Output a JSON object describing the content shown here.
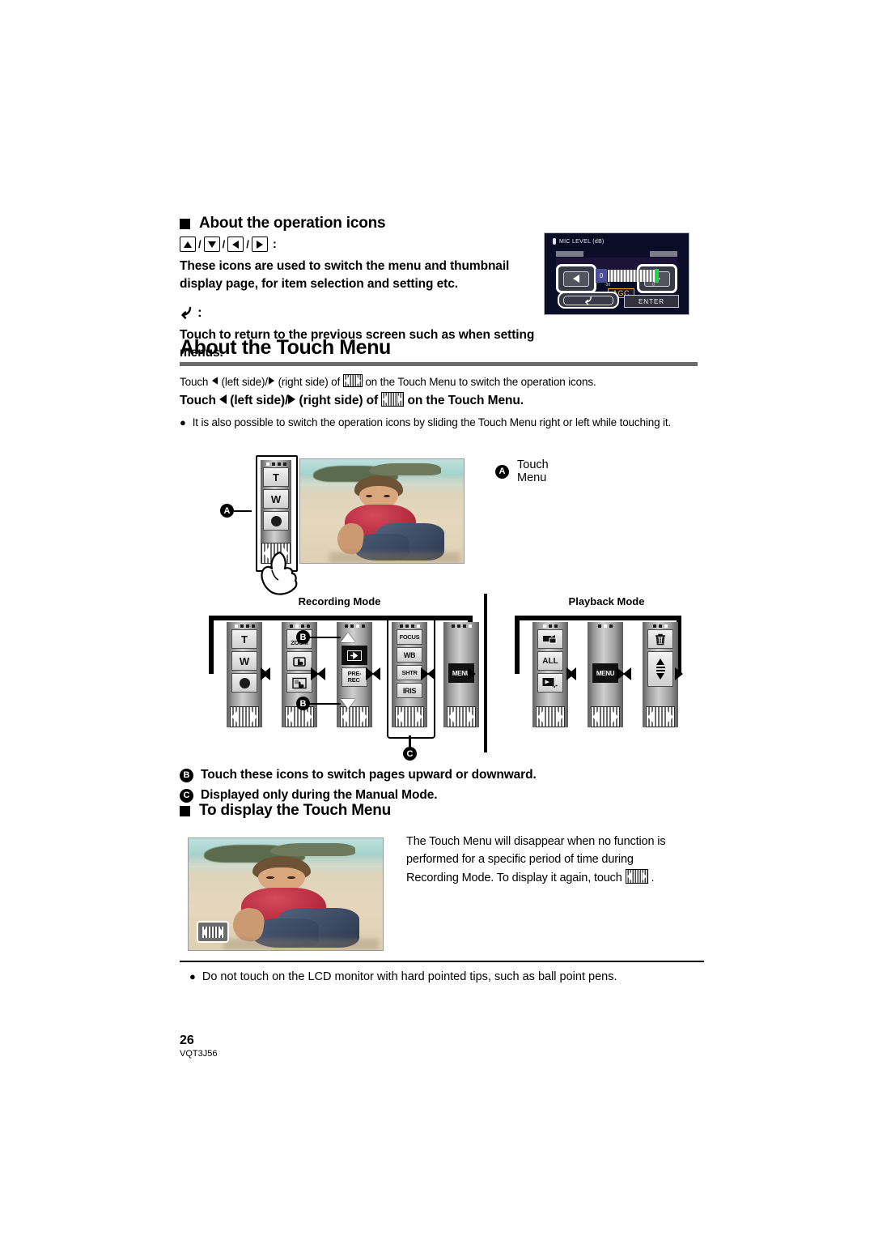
{
  "document": {
    "page_number": "26",
    "doc_code": "VQT3J56"
  },
  "section_operation_icons": {
    "heading": "About the operation icons",
    "arrow_icons_label": ":",
    "arrow_icons_desc": "These icons are used to switch the menu and thumbnail display page, for item selection and setting etc.",
    "return_icon_label": ":",
    "return_icon_desc": "Touch to return to the previous screen such as when setting menus.",
    "lcd": {
      "title": "MIC LEVEL (dB)",
      "value": "0",
      "scale_left": "-30",
      "scale_right": "0",
      "agc_label": "AGC",
      "enter_label": "ENTER",
      "back_label": "↶"
    }
  },
  "section_touch_menu": {
    "title": "About the Touch Menu",
    "line_regular_1": "Touch",
    "line_regular_2": "(left side)/",
    "line_regular_3": "(right side) of",
    "line_regular_4": "on the Touch Menu to switch the operation icons.",
    "line_bold_1": "Touch",
    "line_bold_2": "(left side)/",
    "line_bold_3": "(right side) of",
    "line_bold_4": "on the Touch Menu.",
    "bullet_slide": "It is also possible to switch the operation icons by sliding the Touch Menu right or left while touching it.",
    "callout_a_letter": "A",
    "callout_a_text": "Touch Menu",
    "callout_b_letter": "B",
    "callout_c_letter": "C",
    "note_b": "Touch these icons to switch pages upward or downward.",
    "note_c": "Displayed only during the Manual Mode.",
    "recording_mode_label": "Recording Mode",
    "playback_mode_label": "Playback Mode",
    "strip_intro": {
      "buttons": [
        "T",
        "W"
      ],
      "record_icon": "record-dot-icon"
    },
    "recording_panels": [
      {
        "name": "panel-zoom-record",
        "dots": 4,
        "active_dot": 0,
        "items": [
          {
            "type": "text",
            "label": "T",
            "icon": "zoom-tele-icon"
          },
          {
            "type": "text",
            "label": "W",
            "icon": "zoom-wide-icon"
          },
          {
            "type": "icon",
            "label": "",
            "icon": "record-dot-icon"
          }
        ]
      },
      {
        "name": "panel-touch-functions",
        "dots": 4,
        "active_dot": 1,
        "items": [
          {
            "type": "text",
            "label": "ZOOM",
            "icon": "touch-zoom-icon"
          },
          {
            "type": "icon",
            "label": "",
            "icon": "touch-shutter-icon"
          },
          {
            "type": "icon",
            "label": "",
            "icon": "touch-tracking-icon"
          }
        ]
      },
      {
        "name": "panel-fade-prerec",
        "dots": 4,
        "active_dot": 2,
        "items": [
          {
            "type": "icon",
            "label": "",
            "icon": "fade-icon"
          },
          {
            "type": "text",
            "label": "PRE-REC",
            "icon": "pre-rec-icon"
          }
        ]
      },
      {
        "name": "panel-manual-settings",
        "dots": 4,
        "active_dot": 3,
        "items": [
          {
            "type": "text",
            "label": "FOCUS",
            "icon": "focus-icon"
          },
          {
            "type": "text",
            "label": "WB",
            "icon": "white-balance-icon"
          },
          {
            "type": "text",
            "label": "SHTR",
            "icon": "shutter-speed-icon"
          },
          {
            "type": "text",
            "label": "IRIS",
            "icon": "iris-icon"
          }
        ]
      },
      {
        "name": "panel-menu",
        "dots": 4,
        "active_dot": 3,
        "items": [
          {
            "type": "text",
            "label": "MENU",
            "icon": "menu-icon"
          }
        ]
      }
    ],
    "playback_panels": [
      {
        "name": "panel-media-select",
        "dots": 3,
        "active_dot": 0,
        "items": [
          {
            "type": "icon",
            "label": "",
            "icon": "video-photo-switch-icon"
          },
          {
            "type": "text",
            "label": "ALL",
            "icon": "all-icon"
          },
          {
            "type": "icon",
            "label": "",
            "icon": "highlight-playback-icon"
          }
        ]
      },
      {
        "name": "panel-playback-menu",
        "dots": 3,
        "active_dot": 1,
        "items": [
          {
            "type": "text",
            "label": "MENU",
            "icon": "menu-icon"
          }
        ]
      },
      {
        "name": "panel-delete",
        "dots": 3,
        "active_dot": 2,
        "items": [
          {
            "type": "icon",
            "label": "",
            "icon": "trash-icon"
          },
          {
            "type": "icon",
            "label": "",
            "icon": "page-up-down-icon"
          }
        ]
      }
    ]
  },
  "section_display_touch_menu": {
    "heading": "To display the Touch Menu",
    "paragraph_1": "The Touch Menu will disappear when no function is",
    "paragraph_2": "performed for a specific period of time during",
    "paragraph_3": "Recording Mode. To display it again, touch",
    "paragraph_end": "."
  },
  "footer_note": {
    "bullet": "Do not touch on the LCD monitor with hard pointed tips, such as ball point pens."
  },
  "colors": {
    "rule_gray": "#6b6b6b",
    "text_black": "#000000",
    "agc_orange": "#f0a81e",
    "meter_green": "#25d34a"
  }
}
